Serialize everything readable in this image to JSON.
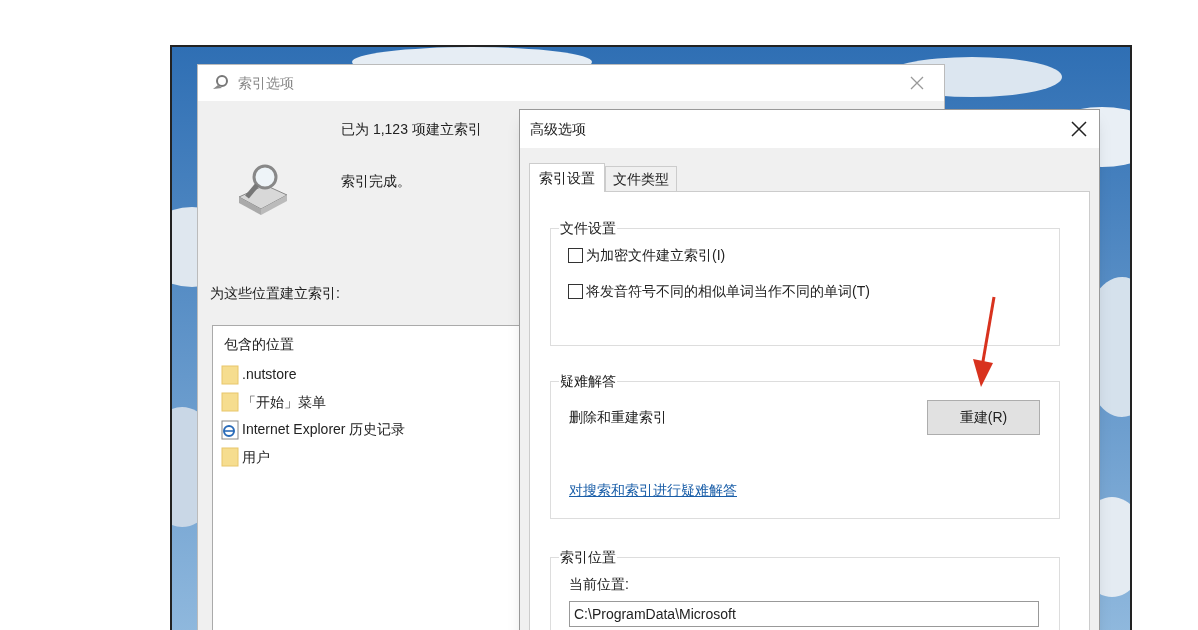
{
  "index_options_window": {
    "title": "索引选项",
    "indexed_count": "已为 1,123 项建立索引",
    "status": "索引完成。",
    "locations_label": "为这些位置建立索引:",
    "locations_list": {
      "header": "包含的位置",
      "items": [
        {
          "kind": "folder",
          "label": ".nutstore"
        },
        {
          "kind": "folder",
          "label": "「开始」菜单"
        },
        {
          "kind": "browser",
          "label": "Internet Explorer 历史记录"
        },
        {
          "kind": "folder",
          "label": "用户"
        }
      ]
    }
  },
  "advanced_options_window": {
    "title": "高级选项",
    "tabs": [
      {
        "label": "索引设置",
        "selected": true
      },
      {
        "label": "文件类型",
        "selected": false
      }
    ],
    "file_settings": {
      "title": "文件设置",
      "checkboxes": [
        {
          "label": "为加密文件建立索引(I)",
          "checked": false
        },
        {
          "label": "将发音符号不同的相似单词当作不同的单词(T)",
          "checked": false
        }
      ]
    },
    "troubleshooting": {
      "title": "疑难解答",
      "rebuild_label": "删除和重建索引",
      "rebuild_button": "重建(R)",
      "link": "对搜索和索引进行疑难解答"
    },
    "index_location": {
      "title": "索引位置",
      "current_label": "当前位置:",
      "path": "C:\\ProgramData\\Microsoft"
    }
  }
}
